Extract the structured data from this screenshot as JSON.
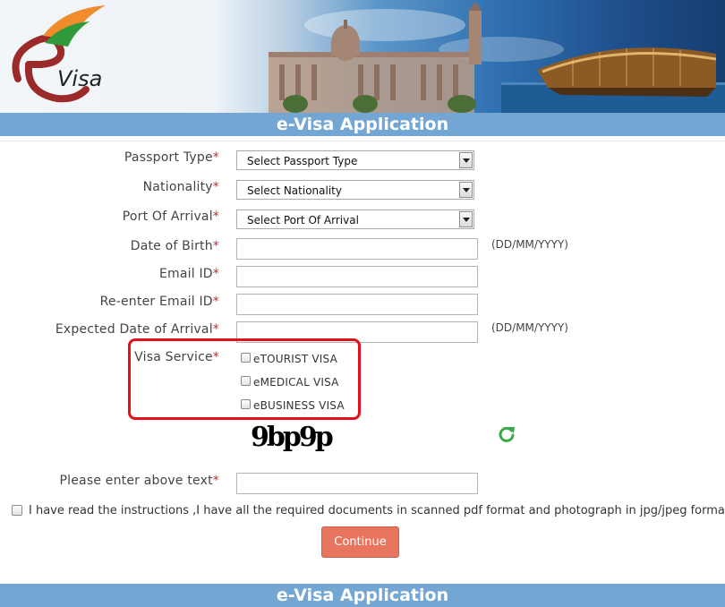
{
  "header": {
    "logo_text": "Visa",
    "title": "e-Visa Application"
  },
  "form": {
    "passport_type": {
      "label": "Passport Type",
      "selected": "Select Passport Type"
    },
    "nationality": {
      "label": "Nationality",
      "selected": "Select Nationality"
    },
    "port_of_arrival": {
      "label": "Port Of Arrival",
      "selected": "Select Port Of Arrival"
    },
    "date_of_birth": {
      "label": "Date of Birth",
      "hint": "(DD/MM/YYYY)",
      "value": ""
    },
    "email": {
      "label": "Email ID",
      "value": ""
    },
    "reenter_email": {
      "label": "Re-enter Email ID",
      "value": ""
    },
    "expected_arrival": {
      "label": "Expected Date of Arrival",
      "hint": "(DD/MM/YYYY)",
      "value": ""
    },
    "visa_service": {
      "label": "Visa Service",
      "options": [
        "eTOURIST VISA",
        "eMEDICAL VISA",
        "eBUSINESS VISA"
      ]
    },
    "captcha_text": "9bp9p",
    "captcha_input": {
      "label": "Please enter above text",
      "value": ""
    },
    "required_marker": "*",
    "agreement": "I have read the instructions ,I have all the required documents in scanned pdf format and photograph in jpg/jpeg format.",
    "continue_label": "Continue"
  },
  "footer": {
    "title": "e-Visa Application"
  },
  "colors": {
    "title_bar": "#74a6d3",
    "required": "#c0282d",
    "highlight_box": "#e3101a",
    "continue_button": "#e9755f",
    "refresh_icon": "#3aa84a"
  },
  "icons": [
    "evisa-logo-icon",
    "refresh-icon",
    "dropdown-arrow-icon"
  ]
}
